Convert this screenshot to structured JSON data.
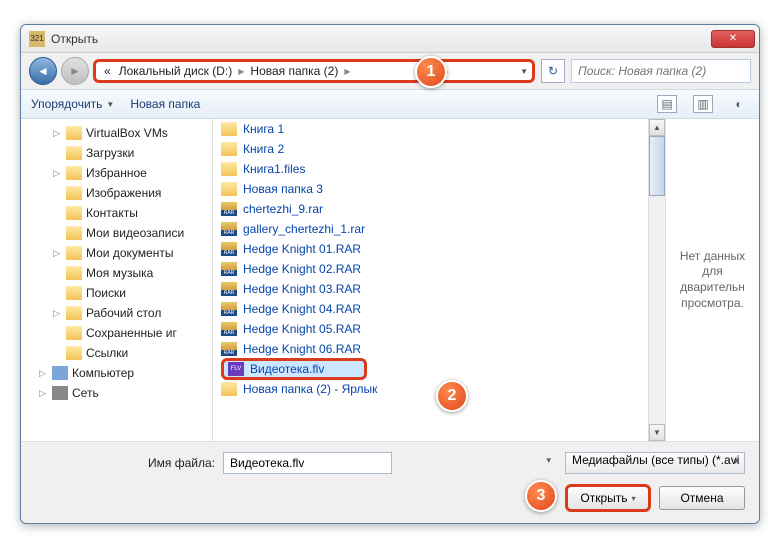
{
  "window": {
    "title": "Открыть"
  },
  "nav": {
    "crumb_prefix": "«",
    "crumb1": "Локальный диск (D:)",
    "crumb2": "Новая папка (2)",
    "search_placeholder": "Поиск: Новая папка (2)"
  },
  "toolbar": {
    "organize": "Упорядочить",
    "newfolder": "Новая папка"
  },
  "sidebar": [
    {
      "label": "VirtualBox VMs",
      "lvl": 1,
      "exp": "▷"
    },
    {
      "label": "Загрузки",
      "lvl": 1,
      "exp": ""
    },
    {
      "label": "Избранное",
      "lvl": 1,
      "exp": "▷"
    },
    {
      "label": "Изображения",
      "lvl": 1,
      "exp": ""
    },
    {
      "label": "Контакты",
      "lvl": 1,
      "exp": ""
    },
    {
      "label": "Мои видеозаписи",
      "lvl": 1,
      "exp": ""
    },
    {
      "label": "Мои документы",
      "lvl": 1,
      "exp": "▷"
    },
    {
      "label": "Моя музыка",
      "lvl": 1,
      "exp": ""
    },
    {
      "label": "Поиски",
      "lvl": 1,
      "exp": ""
    },
    {
      "label": "Рабочий стол",
      "lvl": 1,
      "exp": "▷"
    },
    {
      "label": "Сохраненные иг",
      "lvl": 1,
      "exp": ""
    },
    {
      "label": "Ссылки",
      "lvl": 1,
      "exp": ""
    },
    {
      "label": "Компьютер",
      "lvl": 0,
      "exp": "▷",
      "ico": "comp"
    },
    {
      "label": "Сеть",
      "lvl": 0,
      "exp": "▷",
      "ico": "net"
    }
  ],
  "files": [
    {
      "name": "Книга 1",
      "ico": "fold"
    },
    {
      "name": "Книга 2",
      "ico": "fold"
    },
    {
      "name": "Книга1.files",
      "ico": "fold"
    },
    {
      "name": "Новая папка 3",
      "ico": "fold"
    },
    {
      "name": "chertezhi_9.rar",
      "ico": "rar"
    },
    {
      "name": "gallery_chertezhi_1.rar",
      "ico": "rar"
    },
    {
      "name": "Hedge Knight 01.RAR",
      "ico": "rar"
    },
    {
      "name": "Hedge Knight 02.RAR",
      "ico": "rar"
    },
    {
      "name": "Hedge Knight 03.RAR",
      "ico": "rar"
    },
    {
      "name": "Hedge Knight 04.RAR",
      "ico": "rar"
    },
    {
      "name": "Hedge Knight 05.RAR",
      "ico": "rar"
    },
    {
      "name": "Hedge Knight 06.RAR",
      "ico": "rar"
    },
    {
      "name": "Видеотека.flv",
      "ico": "flv",
      "sel": true
    },
    {
      "name": "Новая папка (2) - Ярлык",
      "ico": "fold"
    }
  ],
  "preview": {
    "text": "Нет данных для дварительн просмотра."
  },
  "footer": {
    "filename_label": "Имя файла:",
    "filename_value": "Видеотека.flv",
    "filter": "Медиафайлы (все типы) (*.avi",
    "open": "Открыть",
    "cancel": "Отмена"
  },
  "callouts": {
    "c1": "1",
    "c2": "2",
    "c3": "3"
  }
}
